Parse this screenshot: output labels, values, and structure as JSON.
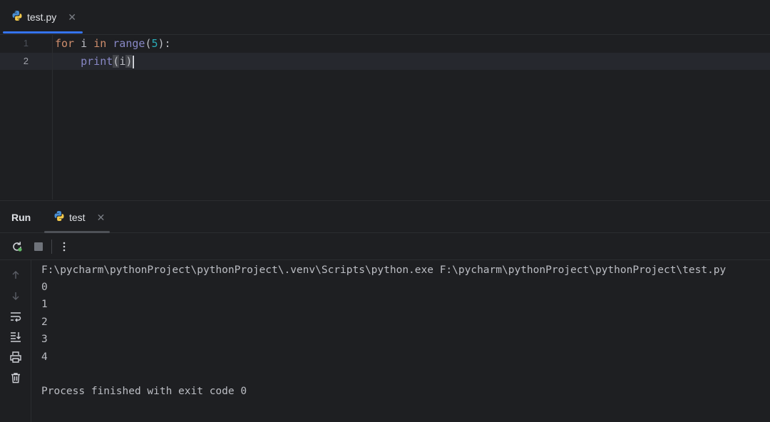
{
  "editor_tabs": [
    {
      "label": "test.py",
      "icon": "python-file-icon",
      "active": true
    }
  ],
  "editor": {
    "line_numbers": [
      "1",
      "2"
    ],
    "lines": [
      {
        "tokens": [
          {
            "text": "for",
            "kind": "keyword"
          },
          {
            "text": " i ",
            "kind": "plain"
          },
          {
            "text": "in",
            "kind": "keyword"
          },
          {
            "text": " ",
            "kind": "plain"
          },
          {
            "text": "range",
            "kind": "builtin"
          },
          {
            "text": "(",
            "kind": "plain"
          },
          {
            "text": "5",
            "kind": "number"
          },
          {
            "text": "):",
            "kind": "plain"
          }
        ]
      },
      {
        "tokens": [
          {
            "text": "    ",
            "kind": "plain"
          },
          {
            "text": "print",
            "kind": "builtin"
          },
          {
            "text": "(",
            "kind": "paren-hl"
          },
          {
            "text": "i",
            "kind": "plain"
          },
          {
            "text": ")",
            "kind": "paren-hl"
          }
        ]
      }
    ]
  },
  "run_panel": {
    "title": "Run",
    "tab_label": "test",
    "console_lines": [
      "F:\\pycharm\\pythonProject\\pythonProject\\.venv\\Scripts\\python.exe F:\\pycharm\\pythonProject\\pythonProject\\test.py",
      "0",
      "1",
      "2",
      "3",
      "4",
      "",
      "Process finished with exit code 0"
    ]
  },
  "colors": {
    "background": "#1e1f22",
    "accent": "#3574f0",
    "keyword": "#cf8e6d",
    "builtin": "#8888c6",
    "number": "#2aacb8",
    "rerun_green": "#5fb865"
  }
}
